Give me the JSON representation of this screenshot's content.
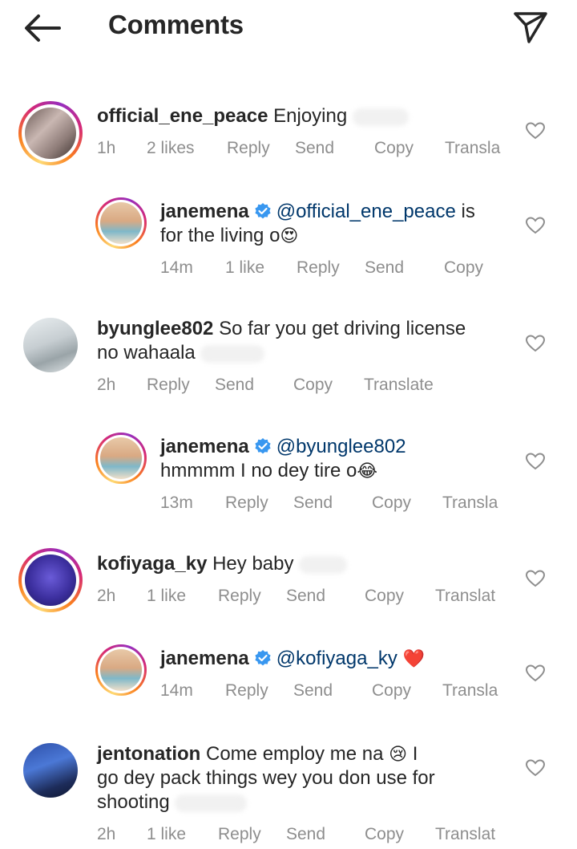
{
  "header": {
    "title": "Comments",
    "back_icon": "arrow-left-icon",
    "send_icon": "paper-plane-icon"
  },
  "comments": [
    {
      "username": "official_ene_peace",
      "text": "Enjoying",
      "time": "1h",
      "likes": "2 likes",
      "reply": "Reply",
      "send": "Send",
      "copy": "Copy",
      "translate": "Transla"
    },
    {
      "username": "janemena",
      "mention": "@official_ene_peace",
      "text_a": " is",
      "text_b": "for the living o",
      "emoji": "😍",
      "time": "14m",
      "likes": "1 like",
      "reply": "Reply",
      "send": "Send",
      "copy": "Copy"
    },
    {
      "username": "byunglee802",
      "text_a": "So far you get driving license",
      "text_b": "no wahaala",
      "time": "2h",
      "reply": "Reply",
      "send": "Send",
      "copy": "Copy",
      "translate": "Translate"
    },
    {
      "username": "janemena",
      "mention": "@byunglee802",
      "text_b": "hmmmm I no dey tire o",
      "emoji": "😂",
      "time": "13m",
      "reply": "Reply",
      "send": "Send",
      "copy": "Copy",
      "translate": "Transla"
    },
    {
      "username": "kofiyaga_ky",
      "text": "Hey baby",
      "time": "2h",
      "likes": "1 like",
      "reply": "Reply",
      "send": "Send",
      "copy": "Copy",
      "translate": "Translat"
    },
    {
      "username": "janemena",
      "mention": "@kofiyaga_ky",
      "emoji": "❤️",
      "time": "14m",
      "reply": "Reply",
      "send": "Send",
      "copy": "Copy",
      "translate": "Transla"
    },
    {
      "username": "jentonation",
      "text_a": "Come employ me na",
      "emoji": "😢",
      "text_a2": " I",
      "text_b": "go dey pack things wey you don use for",
      "text_c": "shooting",
      "time": "2h",
      "likes": "1 like",
      "reply": "Reply",
      "send": "Send",
      "copy": "Copy",
      "translate": "Translat"
    }
  ],
  "colors": {
    "text": "#262626",
    "meta": "#8e8e8e",
    "mention": "#00376b",
    "verified": "#3897f0"
  }
}
